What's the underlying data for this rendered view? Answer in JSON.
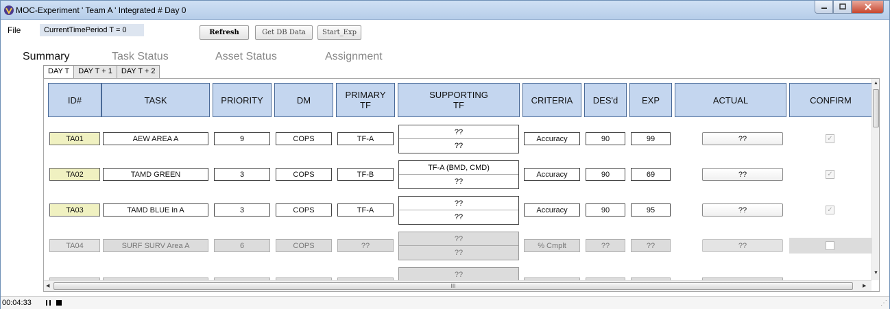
{
  "window": {
    "title": "MOC-Experiment ' Team A '  Integrated # Day 0",
    "minimize": "minimize",
    "maximize": "maximize",
    "close": "close"
  },
  "toolbar": {
    "file": "File",
    "period": "CurrentTimePeriod T = 0",
    "refresh": "Refresh",
    "get_db": "Get DB Data",
    "start_exp": "Start_Exp"
  },
  "nav": {
    "summary": "Summary",
    "task_status": "Task Status",
    "asset_status": "Asset Status",
    "assignment": "Assignment"
  },
  "day_tabs": [
    "DAY T",
    "DAY T + 1",
    "DAY T + 2"
  ],
  "headers": [
    "ID#",
    "TASK",
    "PRIORITY",
    "DM",
    "PRIMARY TF",
    "SUPPORTING TF",
    "CRITERIA",
    "DES'd",
    "EXP",
    "ACTUAL",
    "CONFIRM"
  ],
  "rows": [
    {
      "id": "TA01",
      "task": "AEW AREA A",
      "priority": "9",
      "dm": "COPS",
      "primary": "TF-A",
      "support1": "??",
      "support2": "??",
      "criteria": "Accuracy",
      "desd": "90",
      "exp": "99",
      "actual": "??",
      "confirm": true,
      "enabled": true
    },
    {
      "id": "TA02",
      "task": "TAMD GREEN",
      "priority": "3",
      "dm": "COPS",
      "primary": "TF-B",
      "support1": "TF-A (BMD, CMD)",
      "support2": "??",
      "criteria": "Accuracy",
      "desd": "90",
      "exp": "69",
      "actual": "??",
      "confirm": true,
      "enabled": true
    },
    {
      "id": "TA03",
      "task": "TAMD BLUE in A",
      "priority": "3",
      "dm": "COPS",
      "primary": "TF-A",
      "support1": "??",
      "support2": "??",
      "criteria": "Accuracy",
      "desd": "90",
      "exp": "95",
      "actual": "??",
      "confirm": true,
      "enabled": true
    },
    {
      "id": "TA04",
      "task": "SURF SURV Area A",
      "priority": "6",
      "dm": "COPS",
      "primary": "??",
      "support1": "??",
      "support2": "??",
      "criteria": "% Cmplt",
      "desd": "??",
      "exp": "??",
      "actual": "??",
      "confirm": false,
      "enabled": false
    }
  ],
  "partial_row": {
    "support1": "??"
  },
  "hscroll_grip": "III",
  "status": {
    "elapsed": "00:04:33"
  }
}
